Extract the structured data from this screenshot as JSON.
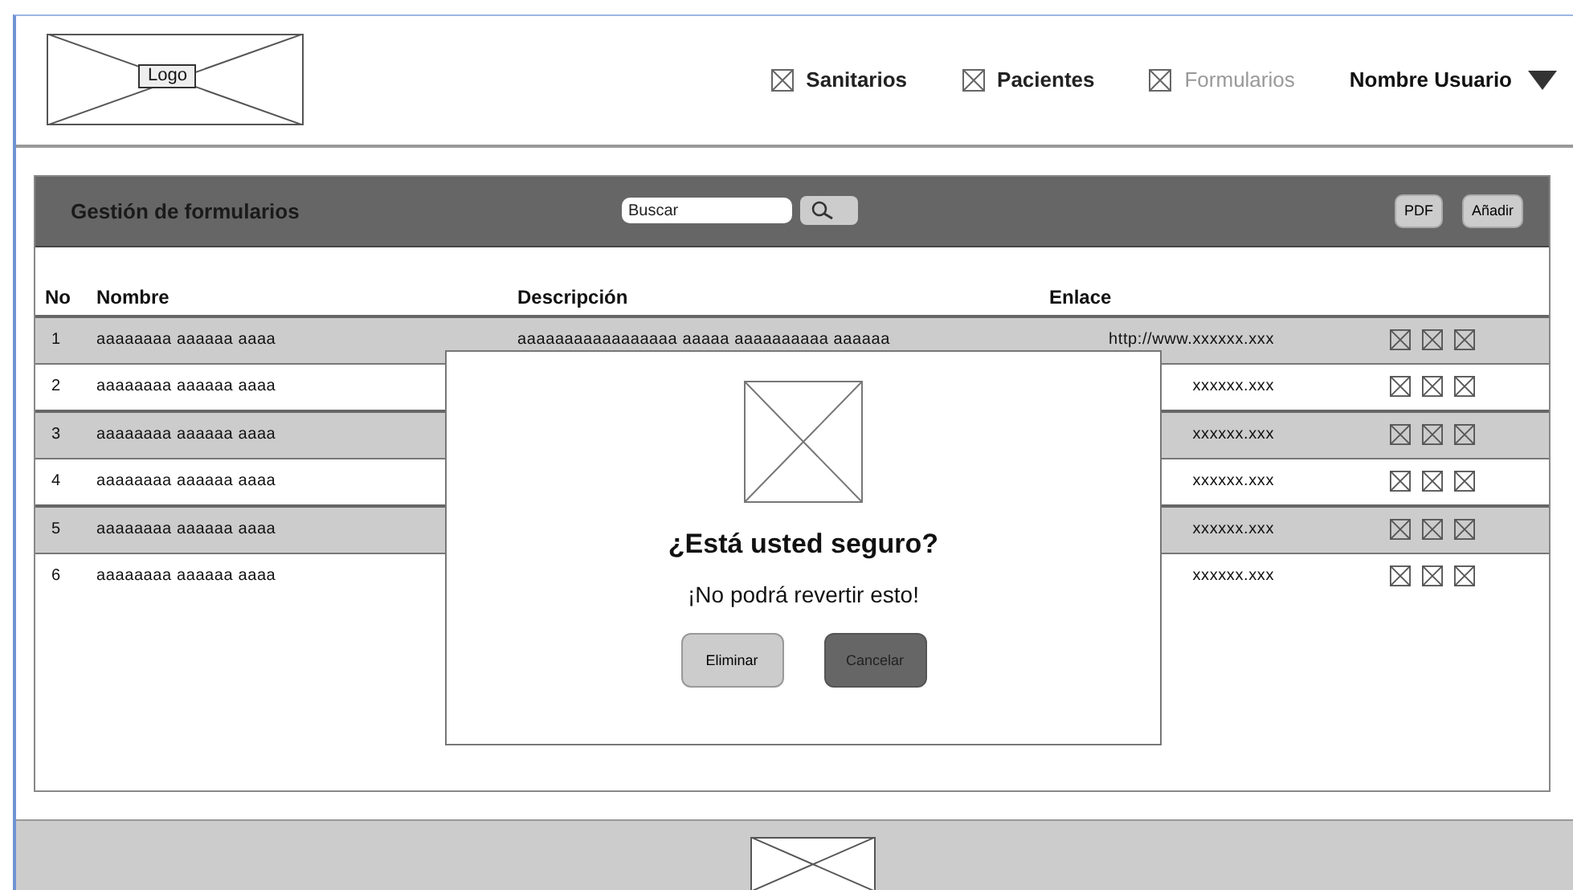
{
  "header": {
    "logo": "Logo",
    "nav": [
      {
        "label": "Sanitarios",
        "selected": false
      },
      {
        "label": "Pacientes",
        "selected": false
      },
      {
        "label": "Formularios",
        "selected": true
      }
    ],
    "user": "Nombre Usuario"
  },
  "panel": {
    "title": "Gestión de formularios",
    "search": {
      "placeholder": "Buscar"
    },
    "buttons": [
      "PDF",
      "Añadir"
    ]
  },
  "table": {
    "columns": [
      "No",
      "Nombre",
      "Descripción",
      "Enlace"
    ],
    "rows": [
      {
        "no": "1",
        "name": "aaaaaaaa aaaaaa  aaaa",
        "description": "aaaaaaaaaaaaaaaaa aaaaa aaaaaaaaaa aaaaaa",
        "link": "http://www.xxxxxx.xxx"
      },
      {
        "no": "2",
        "name": "aaaaaaaa aaaaaa  aaaa",
        "link": "xxxxxx.xxx"
      },
      {
        "no": "3",
        "name": "aaaaaaaa aaaaaa  aaaa",
        "link": "xxxxxx.xxx"
      },
      {
        "no": "4",
        "name": "aaaaaaaa aaaaaa  aaaa",
        "link": "xxxxxx.xxx"
      },
      {
        "no": "5",
        "name": "aaaaaaaa aaaaaa  aaaa",
        "link": "xxxxxx.xxx"
      },
      {
        "no": "6",
        "name": "aaaaaaaa aaaaaa  aaaa",
        "link": "xxxxxx.xxx"
      }
    ]
  },
  "dialog": {
    "title": "¿Está usted seguro?",
    "message": "¡No podrá revertir esto!",
    "buttons": [
      {
        "label": "Eliminar",
        "kind": "secondary"
      },
      {
        "label": "Cancelar",
        "kind": "primary"
      }
    ]
  }
}
